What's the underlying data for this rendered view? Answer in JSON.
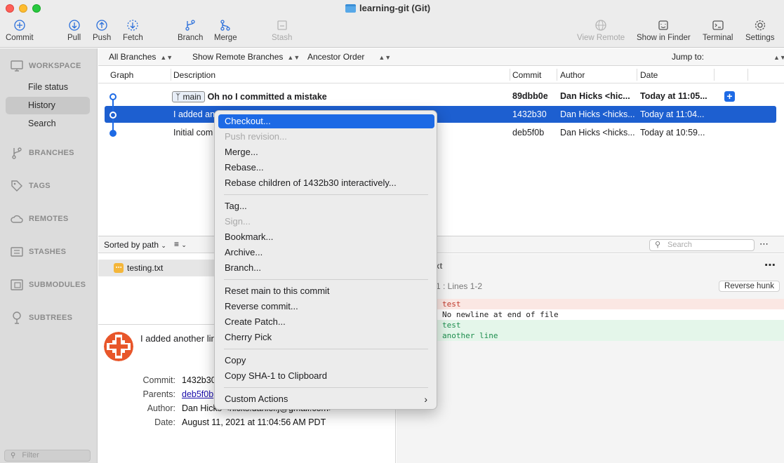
{
  "window": {
    "title": "learning-git (Git)"
  },
  "toolbar": {
    "commit": "Commit",
    "pull": "Pull",
    "push": "Push",
    "fetch": "Fetch",
    "branch": "Branch",
    "merge": "Merge",
    "stash": "Stash",
    "view_remote": "View Remote",
    "show_in_finder": "Show in Finder",
    "terminal": "Terminal",
    "settings": "Settings"
  },
  "sidebar": {
    "workspace": "WORKSPACE",
    "items": [
      {
        "label": "File status"
      },
      {
        "label": "History"
      },
      {
        "label": "Search"
      }
    ],
    "branches": "BRANCHES",
    "tags": "TAGS",
    "remotes": "REMOTES",
    "stashes": "STASHES",
    "submodules": "SUBMODULES",
    "subtrees": "SUBTREES",
    "filter_placeholder": "Filter"
  },
  "filterbar": {
    "all_branches": "All Branches",
    "show_remote": "Show Remote Branches",
    "order": "Ancestor Order",
    "jump_to": "Jump to:"
  },
  "columns": {
    "graph": "Graph",
    "description": "Description",
    "commit": "Commit",
    "author": "Author",
    "date": "Date"
  },
  "commits": [
    {
      "branch": "main",
      "description": "Oh no I committed a mistake",
      "hash": "89dbb0e",
      "author": "Dan Hicks <hic...",
      "date": "Today at 11:05..."
    },
    {
      "description": "I added an",
      "hash": "1432b30",
      "author": "Dan Hicks <hicks...",
      "date": "Today at 11:04..."
    },
    {
      "description": "Initial com",
      "hash": "deb5f0b",
      "author": "Dan Hicks <hicks...",
      "date": "Today at 10:59..."
    }
  ],
  "lower": {
    "sorted_by": "Sorted by path",
    "search_placeholder": "Search",
    "files": [
      {
        "name": "testing.txt"
      }
    ]
  },
  "detail": {
    "message": "I added another lin",
    "commit_label": "Commit:",
    "commit_value": "1432b30",
    "parents_label": "Parents:",
    "parents_value": "deb5f0b",
    "author_label": "Author:",
    "author_value": "Dan Hicks <hicks.daniel.j@gmail.com>",
    "date_label": "Date:",
    "date_value": "August 11, 2021 at 11:04:56 AM PDT"
  },
  "diff": {
    "file": "g.txt",
    "hunk": "nk 1 : Lines 1-2",
    "reverse_hunk": "Reverse hunk",
    "lines": [
      {
        "type": "removed",
        "text": "test"
      },
      {
        "type": "context",
        "text": " No newline at end of file"
      },
      {
        "type": "added",
        "text": "test"
      },
      {
        "type": "added",
        "text": "another line"
      }
    ]
  },
  "context_menu": {
    "items": [
      "Checkout...",
      "Push revision...",
      "Merge...",
      "Rebase...",
      "Rebase children of 1432b30 interactively...",
      "Tag...",
      "Sign...",
      "Bookmark...",
      "Archive...",
      "Branch...",
      "Reset main to this commit",
      "Reverse commit...",
      "Create Patch...",
      "Cherry Pick",
      "Copy",
      "Copy SHA-1 to Clipboard",
      "Custom Actions"
    ]
  },
  "colors": {
    "accent": "#1d6ae5",
    "selection": "#1d5fd0",
    "removed_bg": "#fbe7e3",
    "added_bg": "#e4f6ea"
  }
}
